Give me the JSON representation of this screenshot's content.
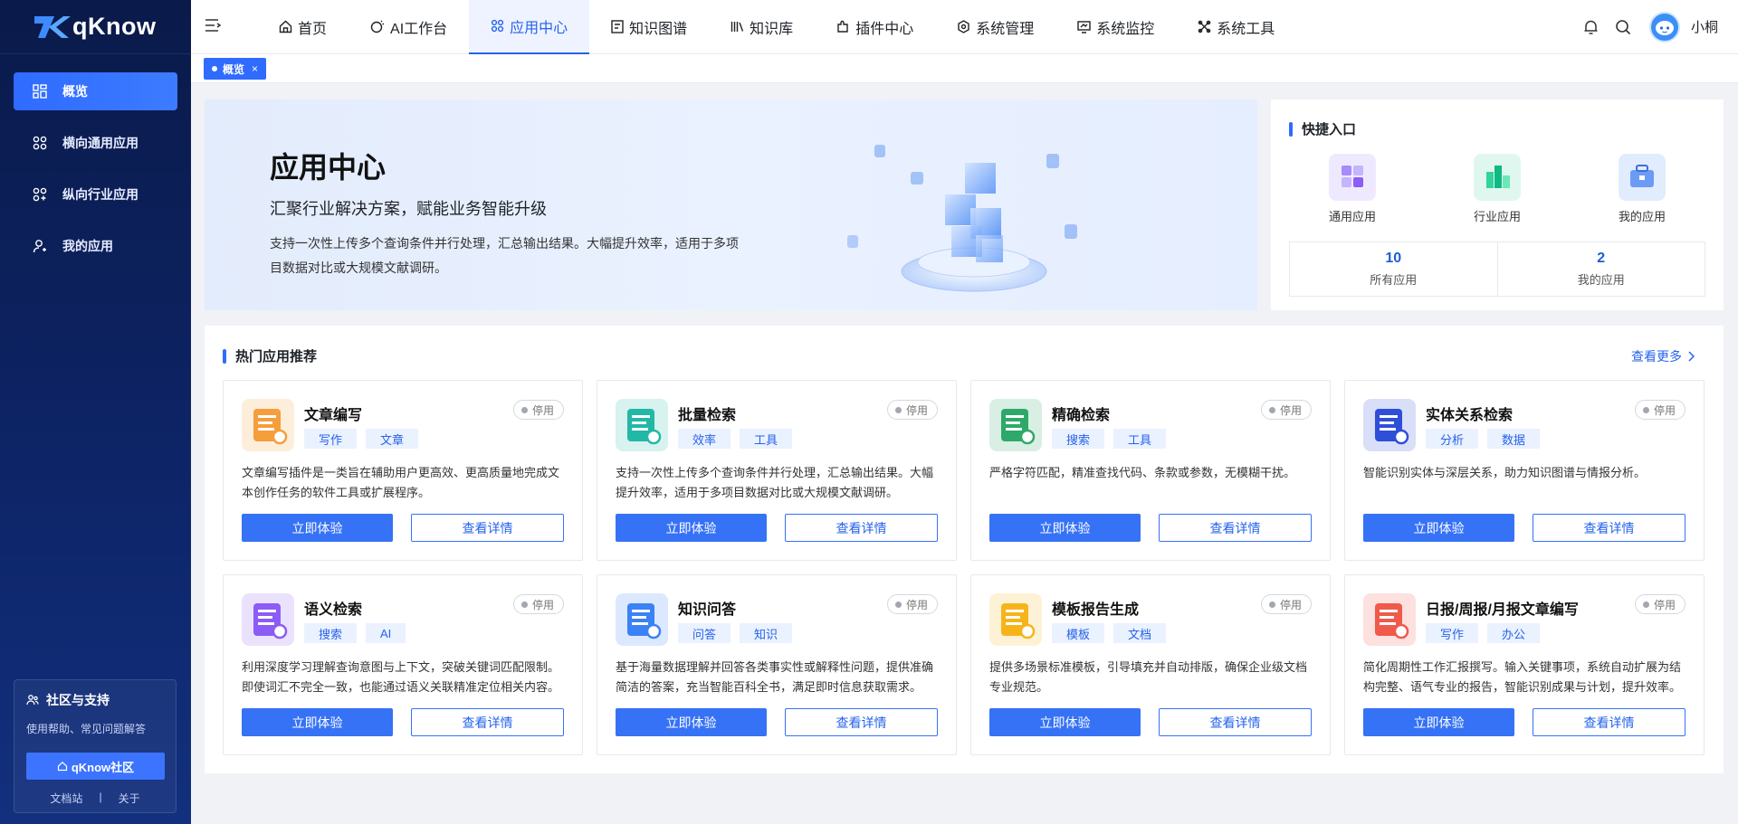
{
  "brand": {
    "name": "qKnow"
  },
  "sidebar": {
    "items": [
      {
        "label": "概览",
        "icon": "dashboard-icon",
        "active": true
      },
      {
        "label": "横向通用应用",
        "icon": "grid-icon",
        "active": false
      },
      {
        "label": "纵向行业应用",
        "icon": "grid-icon",
        "active": false
      },
      {
        "label": "我的应用",
        "icon": "user-icon",
        "active": false
      }
    ],
    "support": {
      "title": "社区与支持",
      "desc": "使用帮助、常见问题解答",
      "button": "qKnow社区",
      "links": [
        "文档站",
        "关于"
      ]
    }
  },
  "topnav": {
    "tabs": [
      {
        "label": "首页",
        "icon": "home-icon"
      },
      {
        "label": "AI工作台",
        "icon": "ai-icon"
      },
      {
        "label": "应用中心",
        "icon": "apps-icon",
        "active": true
      },
      {
        "label": "知识图谱",
        "icon": "graph-icon"
      },
      {
        "label": "知识库",
        "icon": "library-icon"
      },
      {
        "label": "插件中心",
        "icon": "plugin-icon"
      },
      {
        "label": "系统管理",
        "icon": "settings-icon"
      },
      {
        "label": "系统监控",
        "icon": "monitor-icon"
      },
      {
        "label": "系统工具",
        "icon": "tools-icon"
      }
    ],
    "username": "小桐"
  },
  "tagbar": {
    "tag": "概览"
  },
  "banner": {
    "title": "应用中心",
    "subtitle": "汇聚行业解决方案，赋能业务智能升级",
    "desc": "支持一次性上传多个查询条件并行处理，汇总输出结果。大幅提升效率，适用于多项目数据对比或大规模文献调研。"
  },
  "quick": {
    "title": "快捷入口",
    "entries": [
      "通用应用",
      "行业应用",
      "我的应用"
    ],
    "stats": [
      {
        "value": "10",
        "label": "所有应用"
      },
      {
        "value": "2",
        "label": "我的应用"
      }
    ]
  },
  "hot": {
    "title": "热门应用推荐",
    "more": "查看更多",
    "try_label": "立即体验",
    "detail_label": "查看详情",
    "cards": [
      {
        "title": "文章编写",
        "status": "停用",
        "tags": [
          "写作",
          "文章"
        ],
        "desc": "文章编写插件是一类旨在辅助用户更高效、更高质量地完成文本创作任务的软件工具或扩展程序。",
        "color": "#f59e3b"
      },
      {
        "title": "批量检索",
        "status": "停用",
        "tags": [
          "效率",
          "工具"
        ],
        "desc": "支持一次性上传多个查询条件并行处理，汇总输出结果。大幅提升效率，适用于多项目数据对比或大规模文献调研。",
        "color": "#22b8a6"
      },
      {
        "title": "精确检索",
        "status": "停用",
        "tags": [
          "搜索",
          "工具"
        ],
        "desc": "严格字符匹配，精准查找代码、条款或参数，无模糊干扰。",
        "color": "#2ea96a"
      },
      {
        "title": "实体关系检索",
        "status": "停用",
        "tags": [
          "分析",
          "数据"
        ],
        "desc": "智能识别实体与深层关系，助力知识图谱与情报分析。",
        "color": "#2f4fd8"
      },
      {
        "title": "语义检索",
        "status": "停用",
        "tags": [
          "搜索",
          "AI"
        ],
        "desc": "利用深度学习理解查询意图与上下文，突破关键词匹配限制。即使词汇不完全一致，也能通过语义关联精准定位相关内容。",
        "color": "#8b5cf6"
      },
      {
        "title": "知识问答",
        "status": "停用",
        "tags": [
          "问答",
          "知识"
        ],
        "desc": "基于海量数据理解并回答各类事实性或解释性问题，提供准确简洁的答案，充当智能百科全书，满足即时信息获取需求。",
        "color": "#3b82f6"
      },
      {
        "title": "模板报告生成",
        "status": "停用",
        "tags": [
          "模板",
          "文档"
        ],
        "desc": "提供多场景标准模板，引导填充并自动排版，确保企业级文档专业规范。",
        "color": "#f5b51a"
      },
      {
        "title": "日报/周报/月报文章编写",
        "status": "停用",
        "tags": [
          "写作",
          "办公"
        ],
        "desc": "简化周期性工作汇报撰写。输入关键事项，系统自动扩展为结构完整、语气专业的报告，智能识别成果与计划，提升效率。",
        "color": "#ef5a4a"
      }
    ]
  }
}
